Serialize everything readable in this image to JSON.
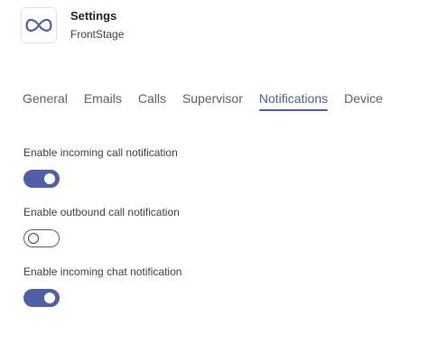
{
  "app": {
    "title": "Settings",
    "subtitle": "FrontStage",
    "icon": "infinity-logo-icon",
    "accent_color": "#4f5fa8"
  },
  "tabs": [
    {
      "label": "General",
      "active": false
    },
    {
      "label": "Emails",
      "active": false
    },
    {
      "label": "Calls",
      "active": false
    },
    {
      "label": "Supervisor",
      "active": false
    },
    {
      "label": "Notifications",
      "active": true
    },
    {
      "label": "Device",
      "active": false
    }
  ],
  "settings": [
    {
      "label": "Enable incoming call notification",
      "enabled": true
    },
    {
      "label": "Enable outbound call notification",
      "enabled": false
    },
    {
      "label": "Enable incoming chat notification",
      "enabled": true
    }
  ]
}
